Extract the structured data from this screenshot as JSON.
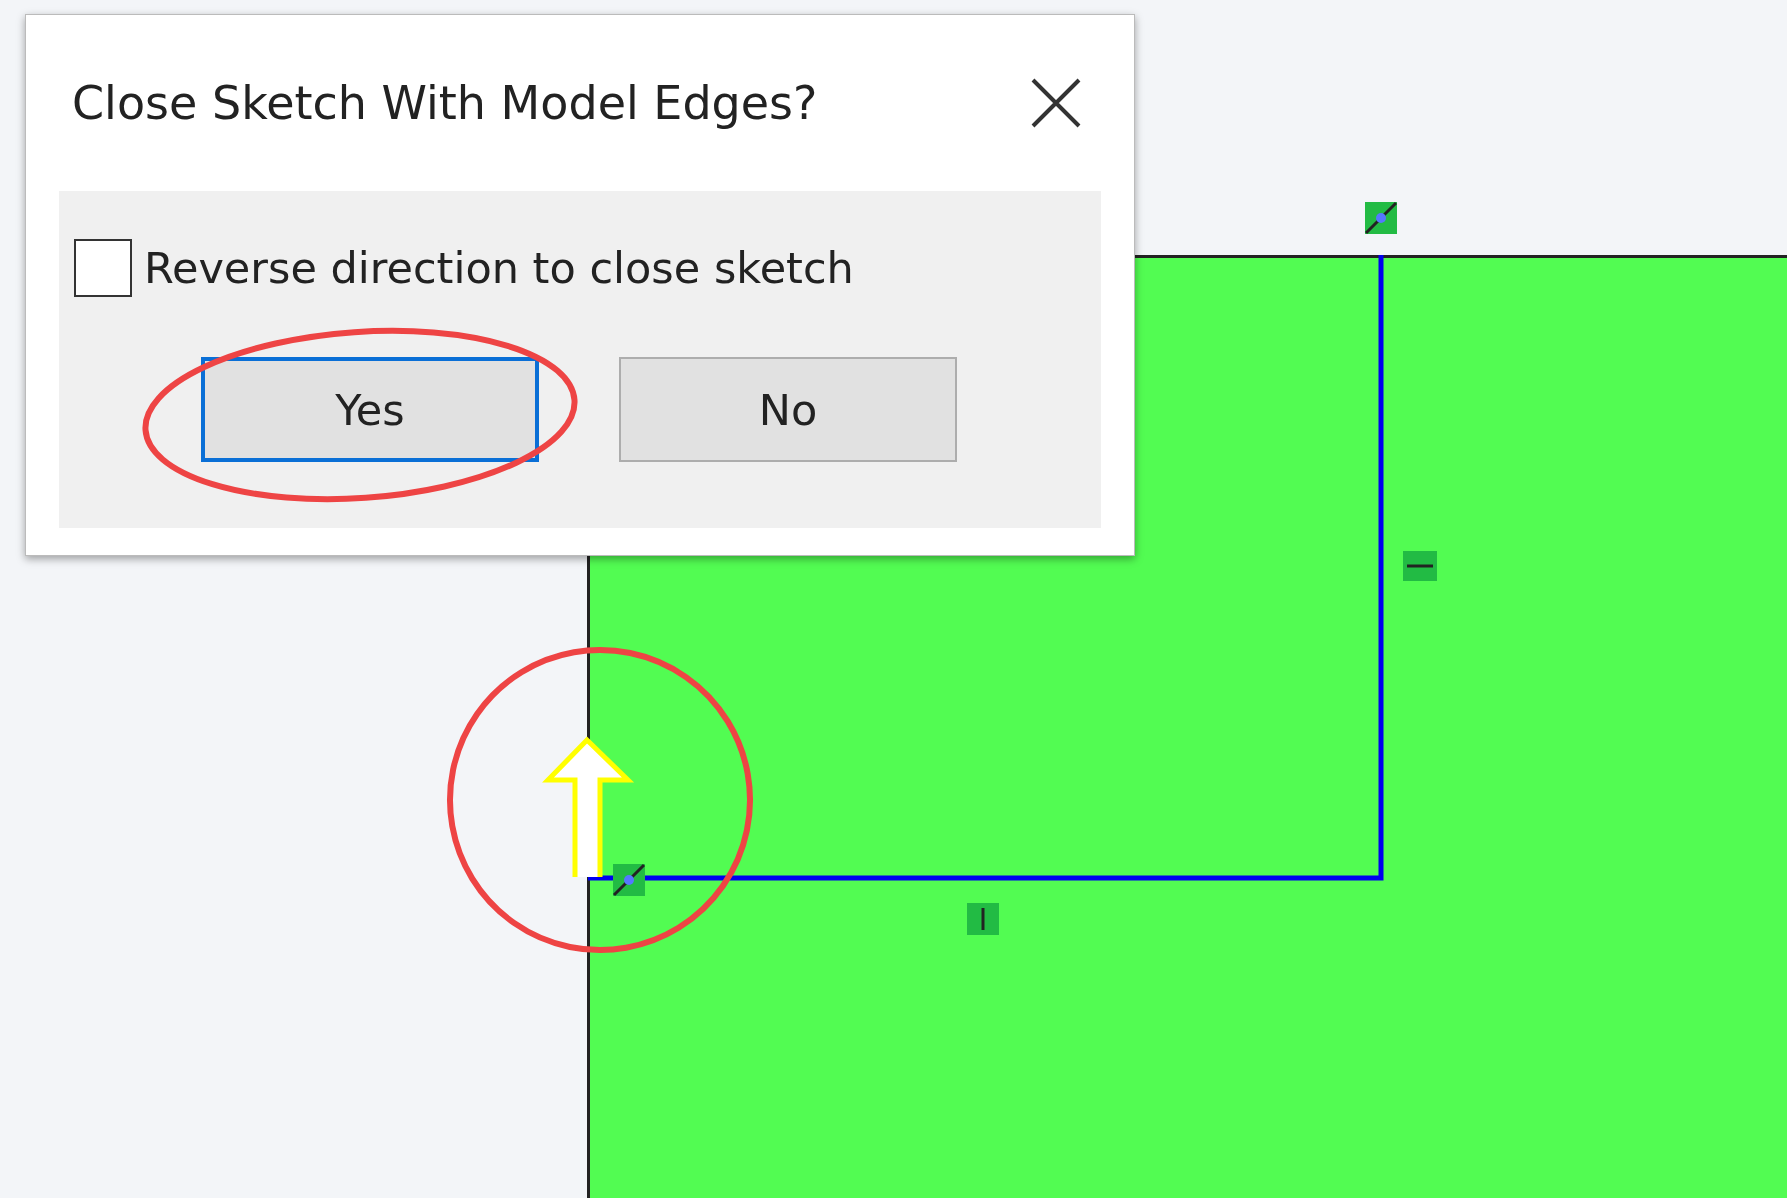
{
  "dialog": {
    "title": "Close Sketch With Model Edges?",
    "checkbox": {
      "label": "Reverse direction to close sketch",
      "checked": false
    },
    "buttons": [
      {
        "label": "Yes",
        "focused": true
      },
      {
        "label": "No",
        "focused": false
      }
    ]
  }
}
